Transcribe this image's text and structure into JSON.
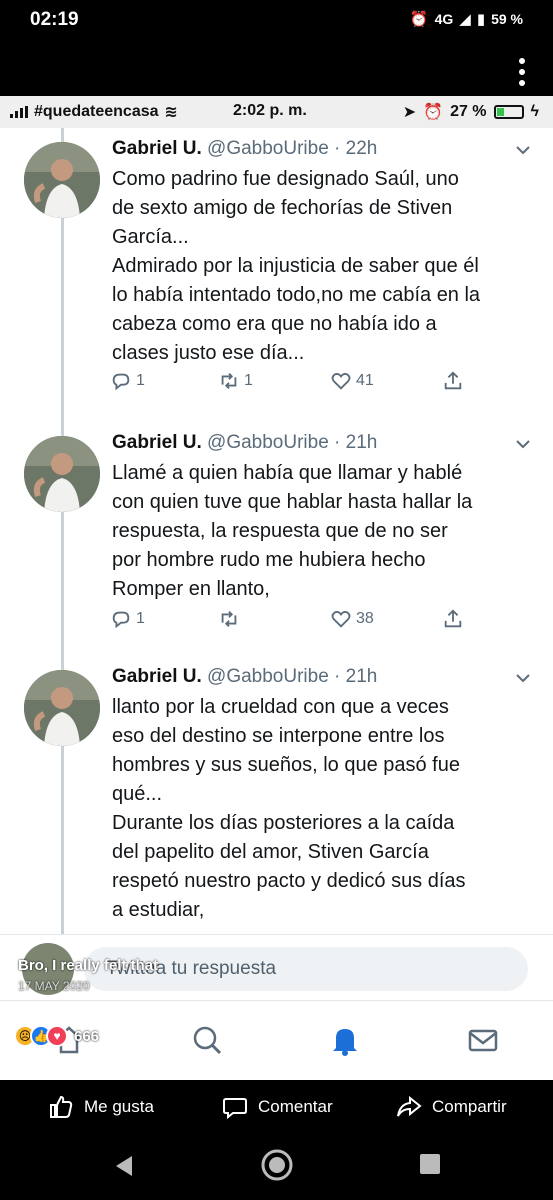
{
  "outer_status": {
    "time": "02:19",
    "network": "4G",
    "battery": "59 %"
  },
  "inner_status": {
    "carrier": "#quedateencasa",
    "time": "2:02 p. m.",
    "battery": "27 %",
    "battery_level": 0.27
  },
  "tweets": [
    {
      "name": "Gabriel U.",
      "handle": "@GabboUribe · 22h",
      "text": "Como padrino fue designado Saúl, uno\nde sexto amigo de fechorías de Stiven\nGarcía...\nAdmirado por la injusticia de saber que él\nlo había intentado todo,no me cabía en la\ncabeza como era que no había ido a\nclases justo ese día...",
      "replies": "1",
      "retweets": "1",
      "likes": "41"
    },
    {
      "name": "Gabriel U.",
      "handle": "@GabboUribe · 21h",
      "text": "Llamé a quien había que llamar y hablé\ncon quien tuve que hablar hasta hallar la\nrespuesta, la respuesta que de no ser\npor hombre rudo me hubiera hecho\nRomper en llanto,",
      "replies": "1",
      "retweets": "",
      "likes": "38"
    },
    {
      "name": "Gabriel U.",
      "handle": "@GabboUribe · 21h",
      "text": "llanto por la crueldad con que a veces\neso del destino se interpone entre los\nhombres y sus sueños, lo que pasó fue\nqué...\nDurante los días posteriores a la caída\ndel papelito del amor, Stiven García\nrespetó nuestro pacto y dedicó sus días\na estudiar,",
      "replies": "",
      "retweets": "",
      "likes": ""
    }
  ],
  "reply": {
    "placeholder": "Twittea tu respuesta"
  },
  "facebook": {
    "caption": "Bro, I really felt that",
    "date": "17 MAY 2020",
    "reaction_count": "666",
    "like_label": "Me gusta",
    "comment_label": "Comentar",
    "share_label": "Compartir"
  },
  "colors": {
    "twitter_blue": "#1da1f2",
    "notification_blue": "#1d6fd8"
  },
  "icons": [
    "reply-icon",
    "retweet-icon",
    "like-icon",
    "share-icon",
    "home-icon",
    "search-icon",
    "bell-icon",
    "mail-icon"
  ]
}
